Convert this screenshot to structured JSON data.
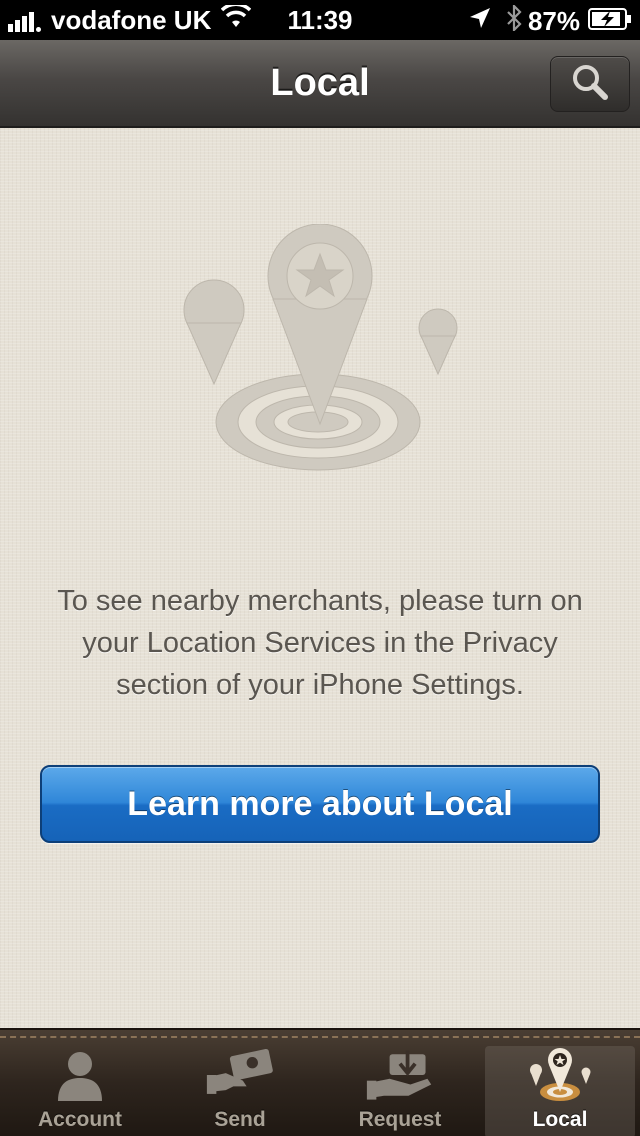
{
  "status_bar": {
    "carrier": "vodafone UK",
    "time": "11:39",
    "battery_percent": "87%"
  },
  "nav": {
    "title": "Local"
  },
  "content": {
    "message": "To see nearby merchants, please turn on your Location Services in the Privacy section of your iPhone Settings.",
    "learn_more_label": "Learn more about Local"
  },
  "tabs": [
    {
      "label": "Account",
      "icon": "person-icon",
      "selected": false
    },
    {
      "label": "Send",
      "icon": "send-money-icon",
      "selected": false
    },
    {
      "label": "Request",
      "icon": "request-money-icon",
      "selected": false
    },
    {
      "label": "Local",
      "icon": "local-pins-icon",
      "selected": true
    }
  ],
  "colors": {
    "accent_blue": "#2f86d8",
    "background": "#e6e1d6",
    "tab_bar": "#2e251e"
  }
}
